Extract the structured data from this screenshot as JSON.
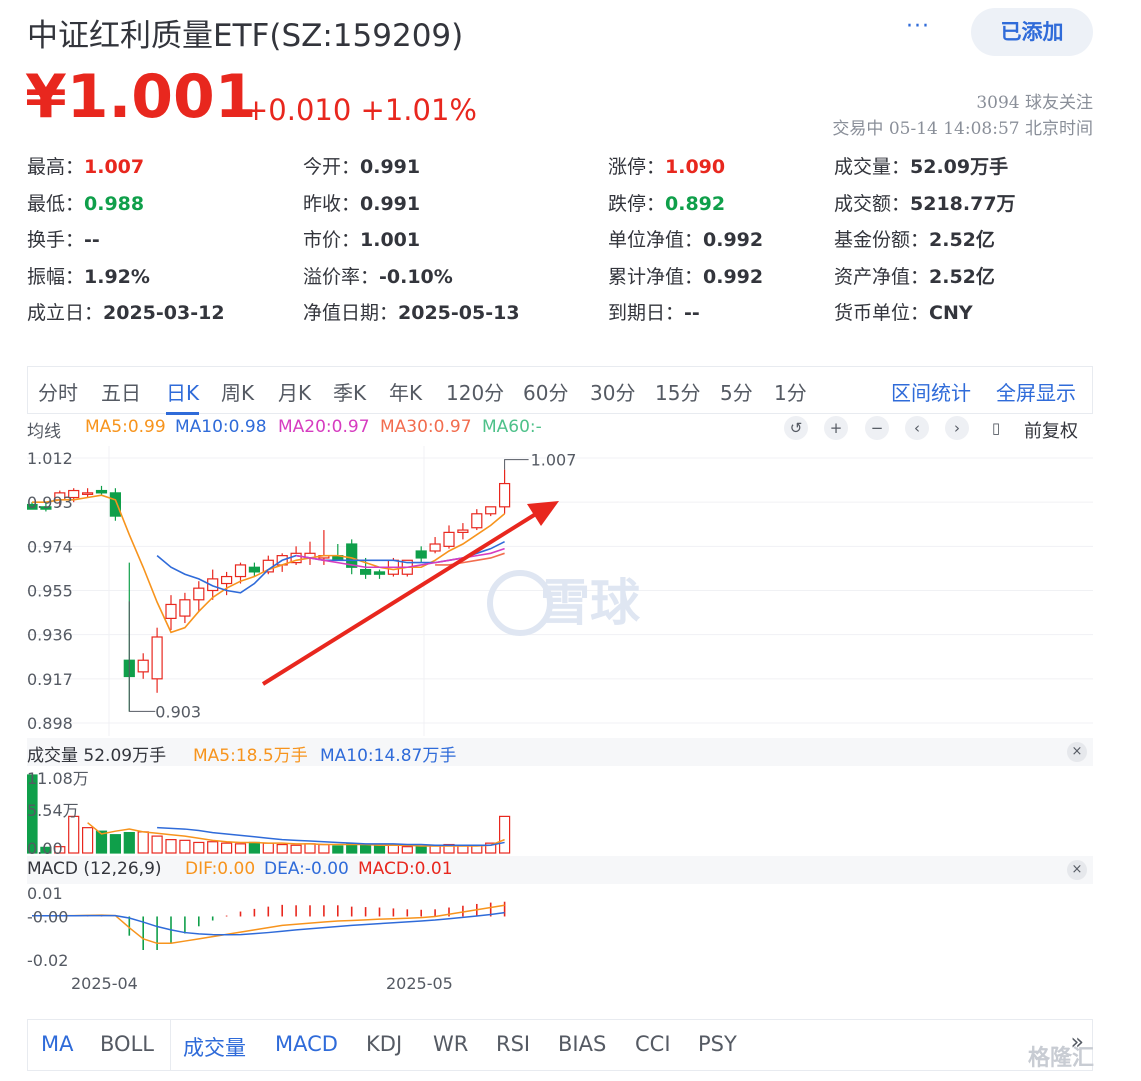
{
  "header": {
    "title": "中证红利质量ETF(SZ:159209)",
    "more_label": "···",
    "added_label": "已添加",
    "price": "¥1.001",
    "change": "+0.010 +1.01%",
    "followers": "3094 球友关注",
    "status": "交易中 05-14 14:08:57 北京时间"
  },
  "quote": [
    {
      "label": "最高：",
      "value": "1.007",
      "tone": "red"
    },
    {
      "label": "今开：",
      "value": "0.991",
      "tone": ""
    },
    {
      "label": "涨停：",
      "value": "1.090",
      "tone": "red"
    },
    {
      "label": "成交量：",
      "value": "52.09万手",
      "tone": ""
    },
    {
      "label": "最低：",
      "value": "0.988",
      "tone": "green"
    },
    {
      "label": "昨收：",
      "value": "0.991",
      "tone": ""
    },
    {
      "label": "跌停：",
      "value": "0.892",
      "tone": "green"
    },
    {
      "label": "成交额：",
      "value": "5218.77万",
      "tone": ""
    },
    {
      "label": "换手：",
      "value": "--",
      "tone": ""
    },
    {
      "label": "市价：",
      "value": "1.001",
      "tone": ""
    },
    {
      "label": "单位净值：",
      "value": "0.992",
      "tone": ""
    },
    {
      "label": "基金份额：",
      "value": "2.52亿",
      "tone": ""
    },
    {
      "label": "振幅：",
      "value": "1.92%",
      "tone": ""
    },
    {
      "label": "溢价率：",
      "value": "-0.10%",
      "tone": ""
    },
    {
      "label": "累计净值：",
      "value": "0.992",
      "tone": ""
    },
    {
      "label": "资产净值：",
      "value": "2.52亿",
      "tone": ""
    },
    {
      "label": "成立日：",
      "value": "2025-03-12",
      "tone": ""
    },
    {
      "label": "净值日期：",
      "value": "2025-05-13",
      "tone": ""
    },
    {
      "label": "到期日：",
      "value": "--",
      "tone": ""
    },
    {
      "label": "货币单位：",
      "value": "CNY",
      "tone": ""
    }
  ],
  "periods": {
    "tabs": [
      "分时",
      "五日",
      "日K",
      "周K",
      "月K",
      "季K",
      "年K",
      "120分",
      "60分",
      "30分",
      "15分",
      "5分",
      "1分"
    ],
    "active": "日K",
    "range_stats": "区间统计",
    "fullscreen": "全屏显示"
  },
  "ma_legend": {
    "label": "均线",
    "ma5": "MA5:0.99",
    "ma10": "MA10:0.98",
    "ma20": "MA20:0.97",
    "ma30": "MA30:0.97",
    "ma60": "MA60:-",
    "adjust": "前复权"
  },
  "volume_legend": {
    "label": "成交量 52.09万手",
    "ma5": "MA5:18.5万手",
    "ma10": "MA10:14.87万手"
  },
  "macd_legend": {
    "label": "MACD (12,26,9)",
    "dif": "DIF:0.00",
    "dea": "DEA:-0.00",
    "macd": "MACD:0.01"
  },
  "watermark": "雪球",
  "indicators": {
    "tabs": [
      "MA",
      "BOLL",
      "成交量",
      "MACD",
      "KDJ",
      "WR",
      "RSI",
      "BIAS",
      "CCI",
      "PSY"
    ],
    "more": "»"
  },
  "corner_mark": "格隆汇",
  "colors": {
    "up": "#e8271e",
    "down": "#0f9f4a",
    "accent": "#2f6bd9",
    "ma5": "#f7941d",
    "ma10": "#2f6bd9",
    "ma20": "#d63cc0",
    "ma30": "#f26d4f",
    "ma60": "#4ec18a"
  },
  "chart_data": [
    {
      "type": "candlestick",
      "y_ticks": [
        "1.012",
        "0.993",
        "0.974",
        "0.955",
        "0.936",
        "0.917",
        "0.898"
      ],
      "ylim": [
        0.898,
        1.012
      ],
      "x_ticks": [
        "2025-04",
        "2025-05"
      ],
      "annotations": {
        "max": "1.007",
        "min": "0.903"
      },
      "candles": [
        {
          "o": 0.992,
          "h": 0.993,
          "l": 0.99,
          "c": 0.99
        },
        {
          "o": 0.991,
          "h": 0.993,
          "l": 0.989,
          "c": 0.99
        },
        {
          "o": 0.994,
          "h": 0.998,
          "l": 0.991,
          "c": 0.997
        },
        {
          "o": 0.995,
          "h": 0.999,
          "l": 0.993,
          "c": 0.998
        },
        {
          "o": 0.997,
          "h": 0.999,
          "l": 0.995,
          "c": 0.997
        },
        {
          "o": 0.998,
          "h": 1.0,
          "l": 0.996,
          "c": 0.997
        },
        {
          "o": 0.997,
          "h": 0.999,
          "l": 0.985,
          "c": 0.987
        },
        {
          "o": 0.925,
          "h": 0.967,
          "l": 0.903,
          "c": 0.918
        },
        {
          "o": 0.92,
          "h": 0.928,
          "l": 0.917,
          "c": 0.925
        },
        {
          "o": 0.917,
          "h": 0.939,
          "l": 0.911,
          "c": 0.935
        },
        {
          "o": 0.943,
          "h": 0.953,
          "l": 0.938,
          "c": 0.949
        },
        {
          "o": 0.944,
          "h": 0.954,
          "l": 0.941,
          "c": 0.951
        },
        {
          "o": 0.951,
          "h": 0.959,
          "l": 0.946,
          "c": 0.956
        },
        {
          "o": 0.955,
          "h": 0.964,
          "l": 0.951,
          "c": 0.96
        },
        {
          "o": 0.958,
          "h": 0.963,
          "l": 0.953,
          "c": 0.961
        },
        {
          "o": 0.961,
          "h": 0.967,
          "l": 0.958,
          "c": 0.966
        },
        {
          "o": 0.965,
          "h": 0.967,
          "l": 0.961,
          "c": 0.963
        },
        {
          "o": 0.963,
          "h": 0.97,
          "l": 0.962,
          "c": 0.968
        },
        {
          "o": 0.966,
          "h": 0.971,
          "l": 0.963,
          "c": 0.97
        },
        {
          "o": 0.967,
          "h": 0.974,
          "l": 0.966,
          "c": 0.971
        },
        {
          "o": 0.969,
          "h": 0.976,
          "l": 0.966,
          "c": 0.971
        },
        {
          "o": 0.969,
          "h": 0.981,
          "l": 0.966,
          "c": 0.97
        },
        {
          "o": 0.97,
          "h": 0.975,
          "l": 0.968,
          "c": 0.968
        },
        {
          "o": 0.975,
          "h": 0.977,
          "l": 0.962,
          "c": 0.965
        },
        {
          "o": 0.964,
          "h": 0.969,
          "l": 0.96,
          "c": 0.962
        },
        {
          "o": 0.963,
          "h": 0.964,
          "l": 0.96,
          "c": 0.962
        },
        {
          "o": 0.962,
          "h": 0.969,
          "l": 0.961,
          "c": 0.968
        },
        {
          "o": 0.962,
          "h": 0.968,
          "l": 0.961,
          "c": 0.968
        },
        {
          "o": 0.972,
          "h": 0.974,
          "l": 0.967,
          "c": 0.969
        },
        {
          "o": 0.972,
          "h": 0.978,
          "l": 0.971,
          "c": 0.975
        },
        {
          "o": 0.974,
          "h": 0.983,
          "l": 0.973,
          "c": 0.98
        },
        {
          "o": 0.98,
          "h": 0.984,
          "l": 0.977,
          "c": 0.981
        },
        {
          "o": 0.982,
          "h": 0.99,
          "l": 0.981,
          "c": 0.988
        },
        {
          "o": 0.988,
          "h": 0.991,
          "l": 0.987,
          "c": 0.991
        },
        {
          "o": 0.991,
          "h": 1.007,
          "l": 0.988,
          "c": 1.001
        }
      ],
      "ma5": [
        0.993,
        0.993,
        0.994,
        0.994,
        0.995,
        0.996,
        0.994,
        0.979,
        0.965,
        0.95,
        0.937,
        0.939,
        0.946,
        0.952,
        0.956,
        0.959,
        0.961,
        0.964,
        0.966,
        0.968,
        0.969,
        0.97,
        0.97,
        0.969,
        0.967,
        0.965,
        0.964,
        0.965,
        0.965,
        0.968,
        0.972,
        0.975,
        0.979,
        0.983,
        0.988
      ],
      "ma10": [
        null,
        null,
        null,
        null,
        null,
        null,
        null,
        null,
        null,
        0.97,
        0.965,
        0.962,
        0.96,
        0.957,
        0.955,
        0.954,
        0.958,
        0.964,
        0.968,
        0.97,
        0.969,
        0.968,
        0.968,
        0.968,
        0.968,
        0.968,
        0.968,
        0.967,
        0.967,
        0.967,
        0.968,
        0.969,
        0.971,
        0.973,
        0.976
      ],
      "ma20": [
        null,
        null,
        null,
        null,
        null,
        null,
        null,
        null,
        null,
        null,
        null,
        null,
        null,
        null,
        null,
        null,
        null,
        null,
        null,
        0.97,
        0.969,
        0.968,
        0.967,
        0.966,
        0.965,
        0.965,
        0.965,
        0.965,
        0.966,
        0.967,
        0.968,
        0.969,
        0.97,
        0.971,
        0.973
      ],
      "ma30": [
        null,
        null,
        null,
        null,
        null,
        null,
        null,
        null,
        null,
        null,
        null,
        null,
        null,
        null,
        null,
        null,
        null,
        null,
        null,
        null,
        null,
        null,
        null,
        null,
        null,
        null,
        null,
        null,
        null,
        0.966,
        0.966,
        0.967,
        0.968,
        0.969,
        0.971
      ]
    },
    {
      "type": "bar",
      "y_ticks": [
        "11.08万",
        "5.54万",
        "0.00"
      ],
      "ylim": [
        0,
        11.08
      ],
      "values": [
        11.08,
        0.8,
        0.9,
        5.2,
        3.6,
        3.1,
        2.6,
        2.9,
        3.0,
        2.4,
        1.9,
        1.8,
        1.5,
        1.6,
        1.4,
        1.3,
        1.5,
        1.4,
        1.2,
        1.1,
        1.3,
        1.2,
        1.0,
        1.3,
        1.1,
        1.0,
        1.1,
        0.9,
        0.9,
        1.0,
        1.2,
        1.0,
        1.1,
        1.4,
        5.2
      ],
      "ma5": [
        null,
        null,
        null,
        null,
        4.3,
        2.7,
        3.1,
        3.4,
        3.0,
        2.8,
        2.6,
        2.4,
        2.1,
        1.8,
        1.6,
        1.5,
        1.5,
        1.4,
        1.4,
        1.3,
        1.3,
        1.2,
        1.2,
        1.2,
        1.2,
        1.1,
        1.1,
        1.1,
        1.0,
        1.0,
        1.0,
        1.0,
        1.0,
        1.1,
        1.9
      ],
      "ma10": [
        null,
        null,
        null,
        null,
        null,
        null,
        null,
        null,
        null,
        3.6,
        3.5,
        3.4,
        3.2,
        2.9,
        2.7,
        2.5,
        2.3,
        2.1,
        1.9,
        1.8,
        1.7,
        1.6,
        1.5,
        1.4,
        1.3,
        1.3,
        1.3,
        1.2,
        1.2,
        1.1,
        1.1,
        1.1,
        1.1,
        1.1,
        1.5
      ]
    },
    {
      "type": "macd",
      "y_ticks": [
        "0.01",
        "-0.00",
        "-0.02"
      ],
      "ylim": [
        -0.0235,
        0.0105
      ],
      "dif": [
        0.0003,
        0.0003,
        0.0003,
        0.0004,
        0.0005,
        0.0006,
        0.0004,
        -0.005,
        -0.01,
        -0.012,
        -0.012,
        -0.011,
        -0.01,
        -0.009,
        -0.008,
        -0.007,
        -0.006,
        -0.005,
        -0.004,
        -0.0035,
        -0.003,
        -0.0025,
        -0.002,
        -0.0018,
        -0.0015,
        -0.0012,
        -0.001,
        -0.0008,
        -0.0005,
        0.0,
        0.001,
        0.002,
        0.003,
        0.004,
        0.005
      ],
      "dea": [
        0.0003,
        0.0003,
        0.0003,
        0.0003,
        0.0004,
        0.0004,
        0.0004,
        -0.0007,
        -0.0025,
        -0.0045,
        -0.006,
        -0.0072,
        -0.0078,
        -0.0081,
        -0.0082,
        -0.0081,
        -0.0077,
        -0.0072,
        -0.0066,
        -0.006,
        -0.0055,
        -0.005,
        -0.0045,
        -0.004,
        -0.0036,
        -0.0032,
        -0.0028,
        -0.0024,
        -0.002,
        -0.0016,
        -0.001,
        -0.0004,
        0.0002,
        0.0009,
        0.0017
      ],
      "macd": [
        0.0,
        0.0,
        0.0,
        0.0002,
        0.0002,
        0.0004,
        0.0,
        -0.0086,
        -0.015,
        -0.015,
        -0.012,
        -0.0076,
        -0.0044,
        -0.0018,
        0.0004,
        0.0022,
        0.0034,
        0.0044,
        0.0052,
        0.005,
        0.005,
        0.005,
        0.005,
        0.0044,
        0.0042,
        0.004,
        0.0036,
        0.0032,
        0.003,
        0.0032,
        0.004,
        0.0048,
        0.0056,
        0.0062,
        0.0066
      ]
    }
  ]
}
